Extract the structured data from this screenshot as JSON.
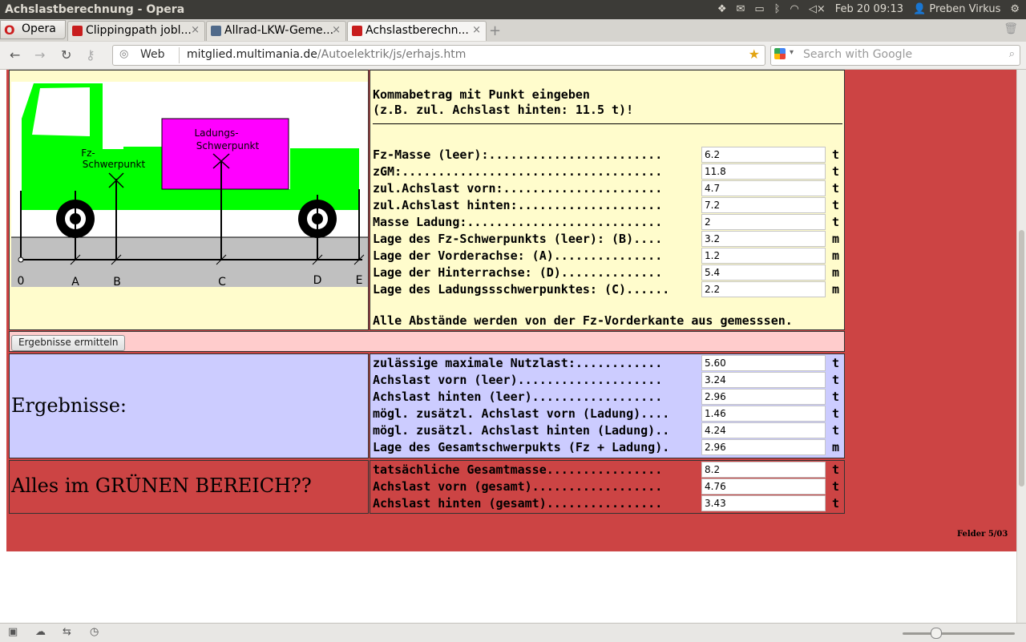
{
  "window": {
    "title": "Achslastberechnung - Opera"
  },
  "system": {
    "datetime": "Feb 20 09:13",
    "user": "Preben Virkus"
  },
  "browser": {
    "menu_label": "Opera",
    "tabs": [
      {
        "label": "Clippingpath jobl...",
        "active": false
      },
      {
        "label": "Allrad-LKW-Geme...",
        "active": false
      },
      {
        "label": "Achslastberechn...",
        "active": true
      }
    ],
    "address": {
      "scope": "Web",
      "url_host": "mitglied.multimania.de",
      "url_path": "/Autoelektrik/js/erhajs.htm"
    },
    "search": {
      "placeholder": "Search with Google"
    }
  },
  "diagram": {
    "labels": {
      "cargo_1": "Ladungs-",
      "cargo_2": "Schwerpunkt",
      "vehicle_1": "Fz-",
      "vehicle_2": "Schwerpunkt"
    },
    "axis": [
      "0",
      "A",
      "B",
      "C",
      "D",
      "E"
    ],
    "colors": {
      "truck": "#00ff00",
      "cargo": "#ff00ff",
      "road": "#c0c0c0",
      "background": "#fffccc"
    }
  },
  "input": {
    "note_line1": "Kommabetrag mit Punkt eingeben",
    "note_line2": "(z.B. zul. Achslast hinten: 11.5 t)!",
    "fields": [
      {
        "label": "Fz-Masse (leer):........................",
        "value": "6.2",
        "unit": "t"
      },
      {
        "label": "zGM:....................................",
        "value": "11.8",
        "unit": "t"
      },
      {
        "label": "zul.Achslast vorn:......................",
        "value": "4.7",
        "unit": "t"
      },
      {
        "label": "zul.Achslast hinten:....................",
        "value": "7.2",
        "unit": "t"
      },
      {
        "label": "Masse Ladung:...........................",
        "value": "2",
        "unit": "t"
      },
      {
        "label": "Lage des Fz-Schwerpunkts (leer): (B)....",
        "value": "3.2",
        "unit": "m"
      },
      {
        "label": "Lage der Vorderachse: (A)...............",
        "value": "1.2",
        "unit": "m"
      },
      {
        "label": "Lage der Hinterrachse: (D)..............",
        "value": "5.4",
        "unit": "m"
      },
      {
        "label": "Lage des Ladungssschwerpunktes: (C)......",
        "value": "2.2",
        "unit": "m"
      }
    ],
    "note_bottom": "Alle Abstände werden von der Fz-Vorderkante aus gemesssen."
  },
  "calc_button": "Ergebnisse ermitteln",
  "results": {
    "heading": "Ergebnisse:",
    "fields": [
      {
        "label": "zulässige maximale Nutzlast:............",
        "value": "5.60",
        "unit": "t"
      },
      {
        "label": "Achslast vorn (leer)....................",
        "value": "3.24",
        "unit": "t"
      },
      {
        "label": "Achslast hinten (leer)..................",
        "value": "2.96",
        "unit": "t"
      },
      {
        "label": "mögl. zusätzl. Achslast vorn (Ladung)....",
        "value": "1.46",
        "unit": "t"
      },
      {
        "label": "mögl. zusätzl. Achslast hinten (Ladung)..",
        "value": "4.24",
        "unit": "t"
      },
      {
        "label": "Lage des Gesamtschwerpukts (Fz + Ladung).",
        "value": "2.96",
        "unit": "m"
      }
    ]
  },
  "check": {
    "heading": "Alles im GRÜNEN BEREICH??",
    "fields": [
      {
        "label": "tatsächliche Gesamtmasse................",
        "value": "8.2",
        "unit": "t"
      },
      {
        "label": "Achslast vorn (gesamt)..................",
        "value": "4.76",
        "unit": "t"
      },
      {
        "label": "Achslast hinten (gesamt)................",
        "value": "3.43",
        "unit": "t"
      }
    ]
  },
  "footer_note": "Felder 5/03"
}
